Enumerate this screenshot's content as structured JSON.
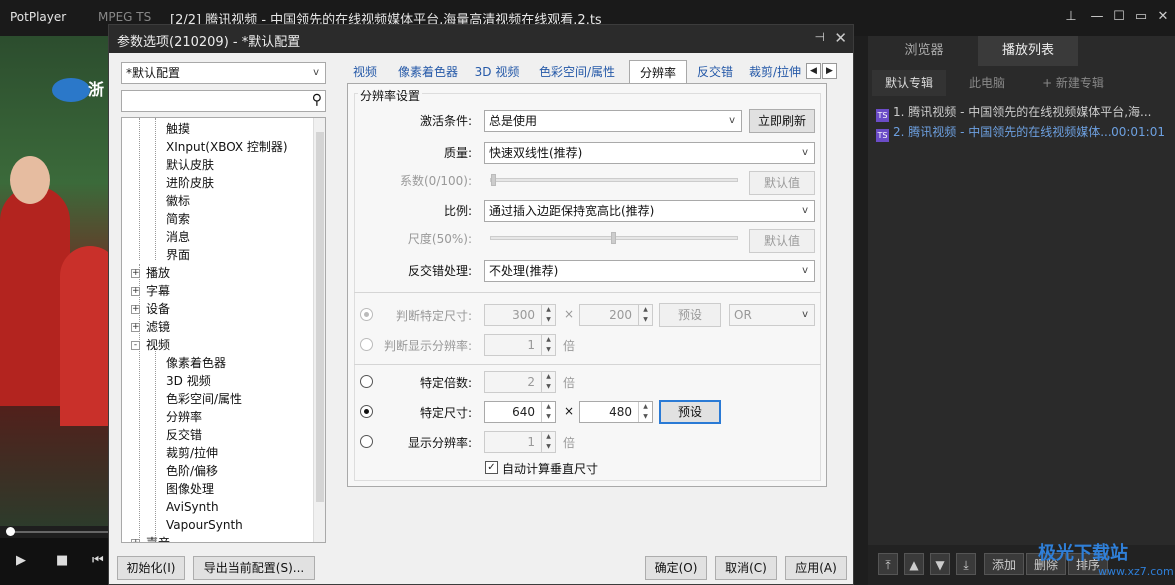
{
  "player": {
    "app_name": "PotPlayer",
    "format": "MPEG TS",
    "title": "[2/2] 腾讯视频 - 中国领先的在线视频媒体平台,海量高清视频在线观看.2.ts",
    "video_logo_text": "浙"
  },
  "dialog": {
    "title": "参数选项(210209) - *默认配置",
    "profile": "*默认配置",
    "search_placeholder": "",
    "tree": [
      {
        "label": "触摸",
        "level": 2
      },
      {
        "label": "XInput(XBOX 控制器)",
        "level": 2
      },
      {
        "label": "默认皮肤",
        "level": 2
      },
      {
        "label": "进阶皮肤",
        "level": 2
      },
      {
        "label": "徽标",
        "level": 2
      },
      {
        "label": "简索",
        "level": 2
      },
      {
        "label": "消息",
        "level": 2
      },
      {
        "label": "界面",
        "level": 2
      },
      {
        "label": "播放",
        "level": 1,
        "expander": "+"
      },
      {
        "label": "字幕",
        "level": 1,
        "expander": "+"
      },
      {
        "label": "设备",
        "level": 1,
        "expander": "+"
      },
      {
        "label": "滤镜",
        "level": 1,
        "expander": "+"
      },
      {
        "label": "视频",
        "level": 1,
        "expander": "-"
      },
      {
        "label": "像素着色器",
        "level": 2
      },
      {
        "label": "3D 视频",
        "level": 2
      },
      {
        "label": "色彩空间/属性",
        "level": 2
      },
      {
        "label": "分辨率",
        "level": 2
      },
      {
        "label": "反交错",
        "level": 2
      },
      {
        "label": "裁剪/拉伸",
        "level": 2
      },
      {
        "label": "色阶/偏移",
        "level": 2
      },
      {
        "label": "图像处理",
        "level": 2
      },
      {
        "label": "AviSynth",
        "level": 2
      },
      {
        "label": "VapourSynth",
        "level": 2
      },
      {
        "label": "声音",
        "level": 1,
        "expander": "+"
      }
    ],
    "tabs": [
      "视频",
      "像素着色器",
      "3D 视频",
      "色彩空间/属性",
      "分辨率",
      "反交错",
      "裁剪/拉伸"
    ],
    "active_tab": "分辨率",
    "group_title": "分辨率设置",
    "activate_label": "激活条件:",
    "activate_value": "总是使用",
    "refresh_button": "立即刷新",
    "quality_label": "质量:",
    "quality_value": "快速双线性(推荐)",
    "coef_label": "系数(0/100):",
    "coef_value": 0,
    "default_button": "默认值",
    "ratio_label": "比例:",
    "ratio_value": "通过插入边距保持宽高比(推荐)",
    "scale_label": "尺度(50%):",
    "scale_value": 50,
    "default_button2": "默认值",
    "deint_label": "反交错处理:",
    "deint_value": "不处理(推荐)",
    "judge_size_label": "判断特定尺寸:",
    "judge_w": "300",
    "times_sign": "×",
    "judge_h": "200",
    "preset_button": "预设",
    "or_value": "OR",
    "judge_res_label": "判断显示分辨率:",
    "judge_res_value": "1",
    "times_unit": "倍",
    "specific_mult_label": "特定倍数:",
    "specific_mult_value": "2",
    "specific_size_label": "特定尺寸:",
    "size_w": "640",
    "size_h": "480",
    "preset_button2": "预设",
    "display_res_label": "显示分辨率:",
    "display_res_value": "1",
    "auto_height_label": "自动计算垂直尺寸",
    "init_button": "初始化(I)",
    "export_button": "导出当前配置(S)...",
    "ok_button": "确定(O)",
    "cancel_button": "取消(C)",
    "apply_button": "应用(A)"
  },
  "panel": {
    "tabs": [
      "浏览器",
      "播放列表"
    ],
    "active_tab": "播放列表",
    "subtabs": [
      "默认专辑",
      "此电脑",
      "+ 新建专辑"
    ],
    "items": [
      {
        "icon": "TS",
        "title": "1. 腾讯视频 - 中国领先的在线视频媒体平台,海...",
        "duration": ""
      },
      {
        "icon": "TS",
        "title": "2. 腾讯视频 - 中国领先的在线视频媒体...",
        "duration": "00:01:01"
      }
    ],
    "bottom": {
      "add": "添加",
      "delete": "删除",
      "sort": "排序"
    },
    "watermark": "极光下载站",
    "watermark_url": "www.xz7.com"
  },
  "colors": {
    "accent": "#2a7ad5",
    "playlist_active": "#6da0e0",
    "tab_link": "#2559a8"
  }
}
